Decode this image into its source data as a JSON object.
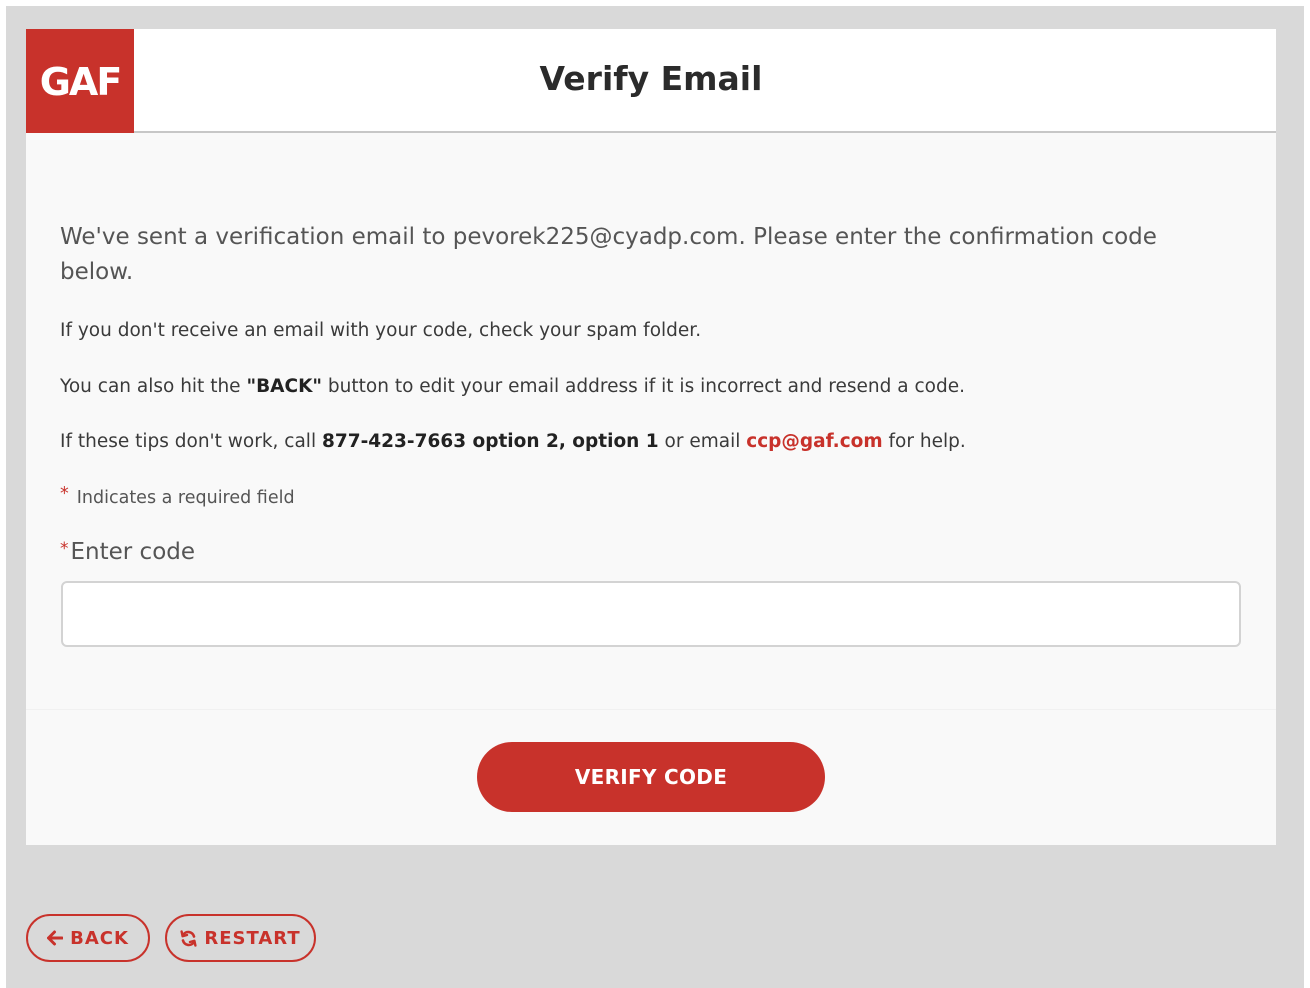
{
  "header": {
    "logo_text": "GAF",
    "title": "Verify Email"
  },
  "content": {
    "lead": "We've sent a verification email to pevorek225@cyadp.com.  Please enter the confirmation code below.",
    "tip1": "If you don't receive an email with your code, check your spam folder.",
    "tip2": {
      "before": "You can also hit the ",
      "emphasis": "\"BACK\"",
      "after": " button to edit your email address if it is incorrect and resend a code."
    },
    "tip3": {
      "before": "If these tips don't work, call ",
      "phone": "877-423-7663 option 2, option 1",
      "middle": " or email ",
      "email": "ccp@gaf.com",
      "after": " for help."
    },
    "required_marker": "*",
    "required_note": "Indicates a required field"
  },
  "form": {
    "code_label": "Enter code",
    "code_value": "",
    "verify_label": "VERIFY CODE"
  },
  "nav": {
    "back_label": "BACK",
    "restart_label": "RESTART"
  },
  "colors": {
    "brand": "#c8322b",
    "page_background": "#d9d9d9",
    "card_background": "#f9f9f9"
  },
  "icons": {
    "back": "arrow-left-icon",
    "restart": "refresh-icon"
  }
}
